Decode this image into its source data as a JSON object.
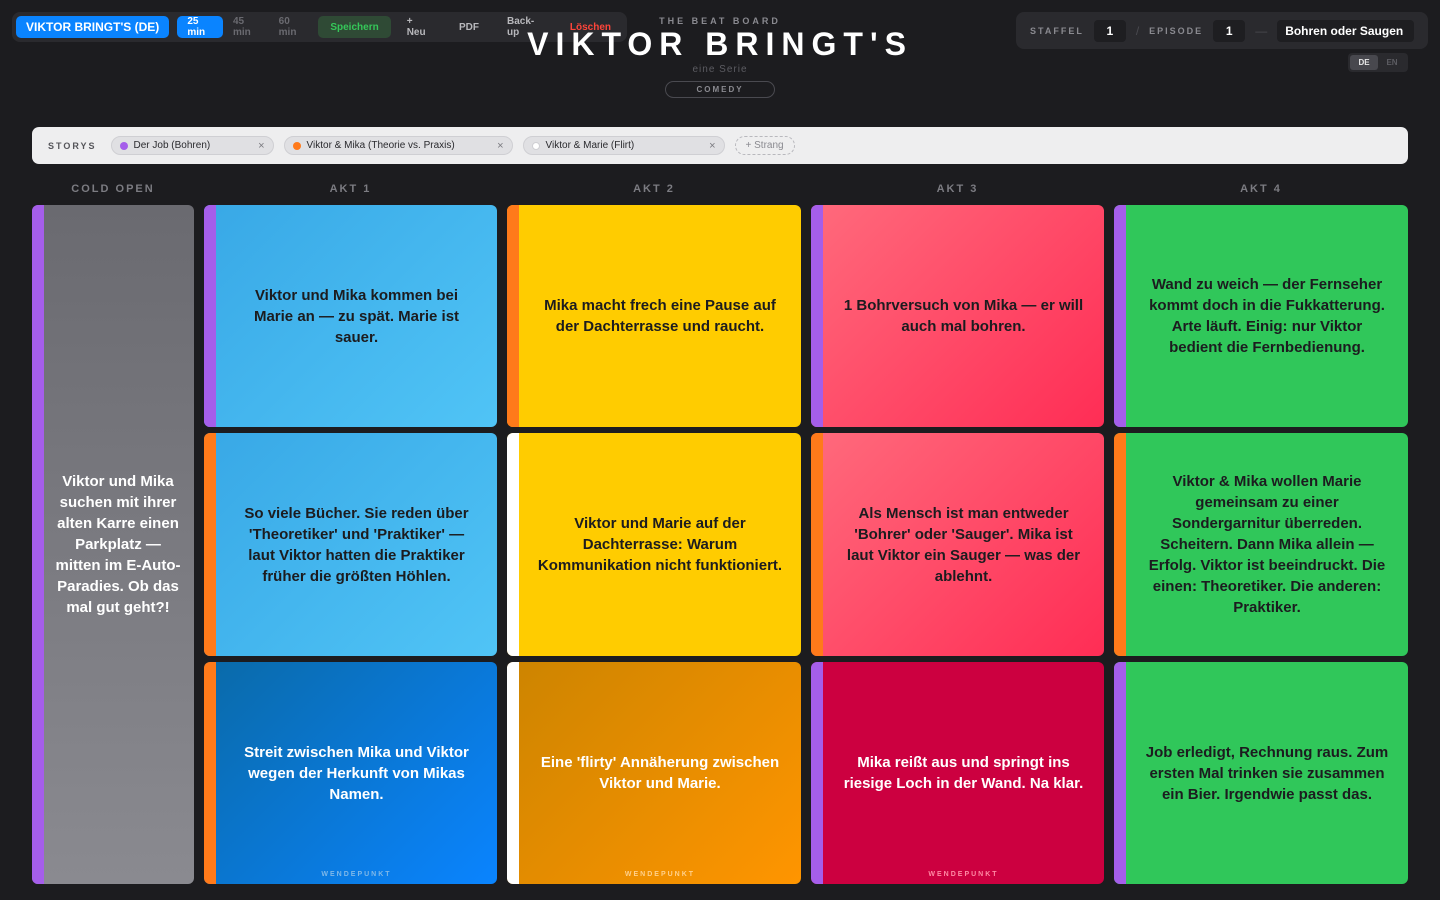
{
  "toolbar": {
    "show_button": "VIKTOR BRINGT'S (DE)",
    "durations": [
      "25 min",
      "45 min",
      "60 min"
    ],
    "save": "Speichern",
    "new": "+ Neu",
    "pdf": "PDF",
    "backup": "Back-up",
    "delete": "Löschen"
  },
  "header": {
    "kicker": "THE BEAT BOARD",
    "title": "VIKTOR BRINGT'S",
    "subtitle": "eine Serie",
    "genre": "COMEDY"
  },
  "episode": {
    "season_label": "STAFFEL",
    "season": "1",
    "separator": "/",
    "episode_label": "EPISODE",
    "episode": "1",
    "dash": "—",
    "title": "Bohren oder Saugen"
  },
  "language": {
    "options": [
      "DE",
      "EN"
    ],
    "active": "DE"
  },
  "stories": {
    "label": "STORYS",
    "items": [
      {
        "label": "Der Job (Bohren)",
        "color": "#a55eea"
      },
      {
        "label": "Viktor & Mika (Theorie vs. Praxis)",
        "color": "#ff7a1a"
      },
      {
        "label": "Viktor & Marie (Flirt)",
        "color": "#ffffff"
      }
    ],
    "add_label": "+ Strang",
    "remove_symbol": "×"
  },
  "columns": [
    "COLD OPEN",
    "AKT 1",
    "AKT 2",
    "AKT 3",
    "AKT 4"
  ],
  "cold_open": {
    "text": "Viktor und Mika suchen mit ihrer alten Karre einen Parkplatz — mitten im E-Auto-Paradies. Ob das mal gut geht?!",
    "stripe": "#a55eea"
  },
  "acts": [
    [
      {
        "text": "Viktor und Mika kommen bei Marie an — zu spät. Marie ist sauer.",
        "stripe": "#a55eea"
      },
      {
        "text": "So viele Bücher. Sie reden über 'Theoretiker' und 'Praktiker' — laut Viktor hatten die Praktiker früher die größten Höhlen.",
        "stripe": "#ff7a1a"
      },
      {
        "text": "Streit zwischen Mika und Viktor wegen der Herkunft von Mikas Namen.",
        "stripe": "#ff7a1a",
        "turn": "WENDEPUNKT"
      }
    ],
    [
      {
        "text": "Mika macht frech eine Pause auf der Dachterrasse und raucht.",
        "stripe": "#ff7a1a"
      },
      {
        "text": "Viktor und Marie auf der Dachterrasse: Warum Kommunikation nicht funktioniert.",
        "stripe": "#ffffff"
      },
      {
        "text": "Eine 'flirty' Annäherung zwischen Viktor und Marie.",
        "stripe": "#ffffff",
        "turn": "WENDEPUNKT"
      }
    ],
    [
      {
        "text": "1 Bohrversuch von Mika — er will auch mal bohren.",
        "stripe": "#a55eea"
      },
      {
        "text": "Als Mensch ist man entweder 'Bohrer' oder 'Sauger'. Mika ist laut Viktor ein Sauger — was der ablehnt.",
        "stripe": "#ff7a1a"
      },
      {
        "text": "Mika reißt aus und springt ins riesige Loch in der Wand. Na klar.",
        "stripe": "#a55eea",
        "turn": "WENDEPUNKT"
      }
    ],
    [
      {
        "text": "Wand zu weich — der Fernseher kommt doch in die Fukkatterung. Arte läuft. Einig: nur Viktor bedient die Fernbedienung.",
        "stripe": "#a55eea"
      },
      {
        "text": "Viktor & Mika wollen Marie gemeinsam zu einer Sondergarnitur überreden. Scheitern. Dann Mika allein — Erfolg. Viktor ist beeindruckt. Die einen: Theoretiker. Die anderen: Praktiker.",
        "stripe": "#ff7a1a"
      },
      {
        "text": "Job erledigt, Rechnung raus. Zum ersten Mal trinken sie zusammen ein Bier. Irgendwie passt das.",
        "stripe": "#a55eea"
      }
    ]
  ],
  "colors": {
    "accent": "#0a84ff",
    "save": "#35c759",
    "delete": "#ff453a",
    "act1": [
      "#3aa8e8",
      "#0a84ff"
    ],
    "act2": [
      "#ffcc00",
      "#ff9500"
    ],
    "act3": [
      "#ff5a6e",
      "#c8003a"
    ],
    "act4": [
      "#34c759"
    ],
    "cold_open": "#78787e"
  }
}
